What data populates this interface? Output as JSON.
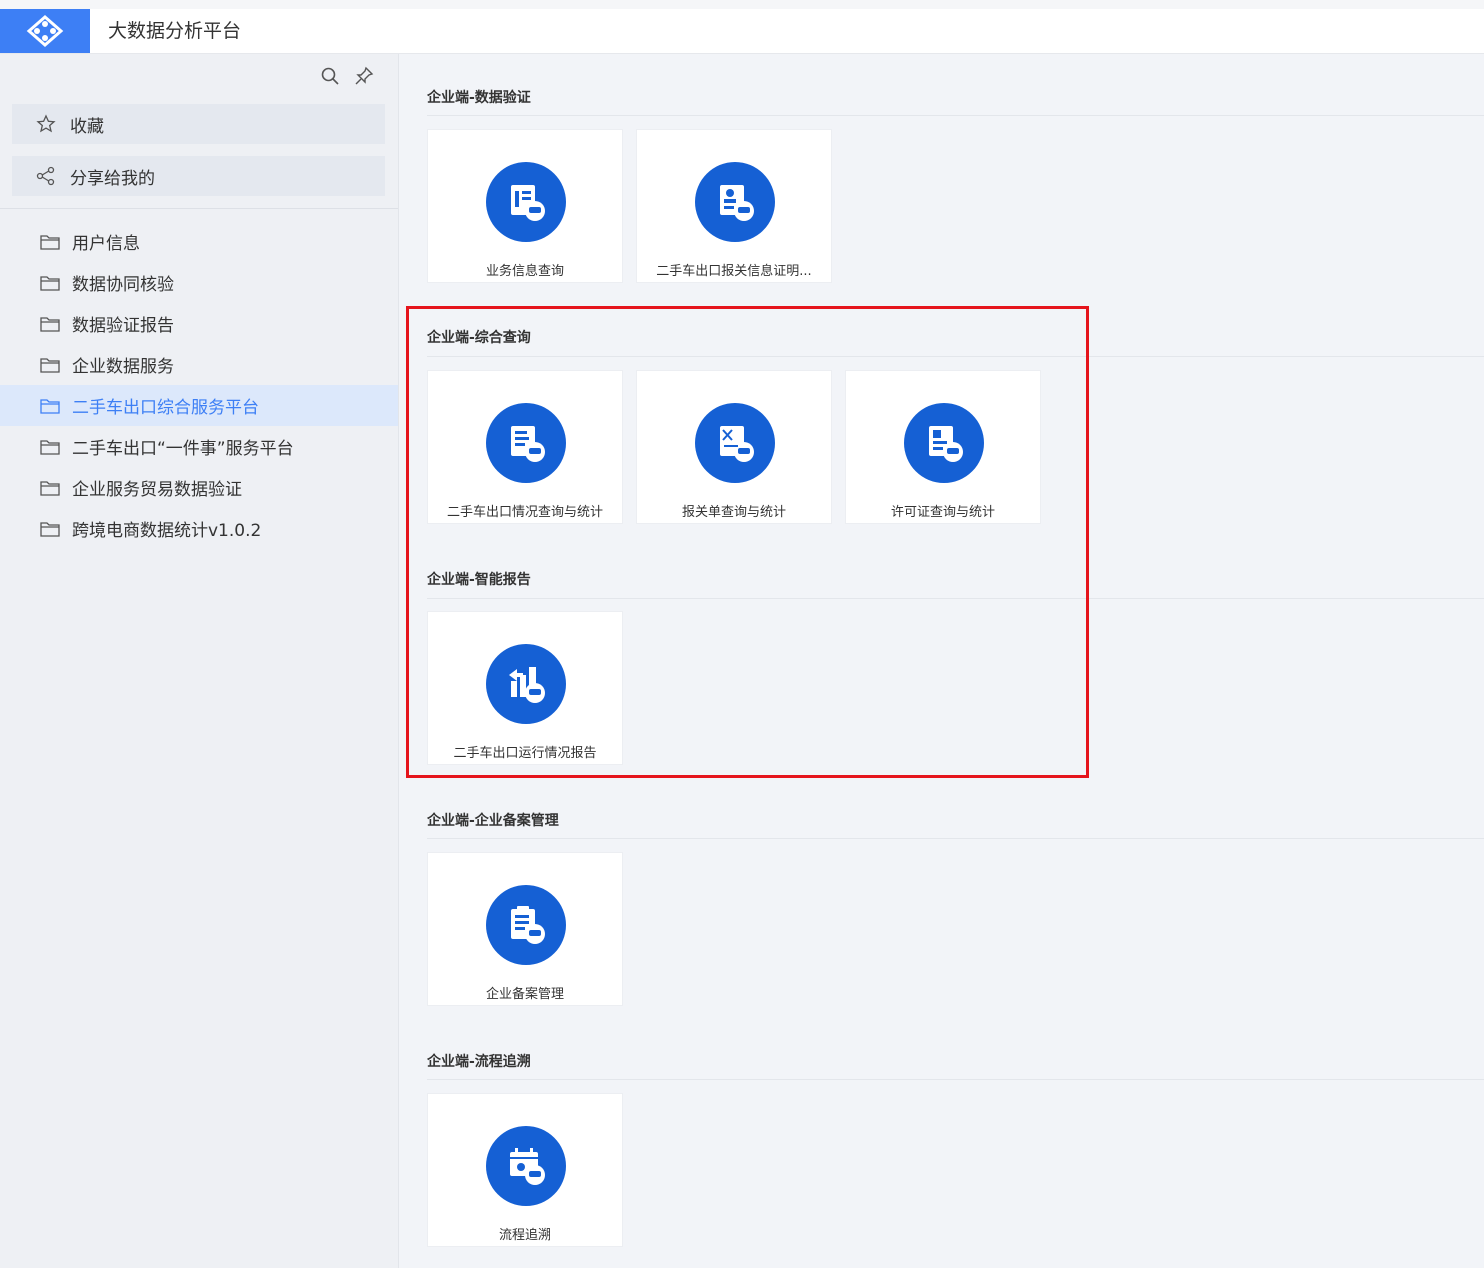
{
  "header": {
    "app_title": "大数据分析平台"
  },
  "sidebar": {
    "favorites": [
      {
        "label": "收藏"
      },
      {
        "label": "分享给我的"
      }
    ],
    "items": [
      {
        "label": "用户信息"
      },
      {
        "label": "数据协同核验"
      },
      {
        "label": "数据验证报告"
      },
      {
        "label": "企业数据服务"
      },
      {
        "label": "二手车出口综合服务平台",
        "active": true
      },
      {
        "label": "二手车出口“一件事”服务平台"
      },
      {
        "label": "企业服务贸易数据验证"
      },
      {
        "label": "跨境电商数据统计v1.0.2"
      }
    ]
  },
  "sections": [
    {
      "title": "企业端-数据验证",
      "cards": [
        {
          "label": "业务信息查询",
          "icon": "document-car-icon"
        },
        {
          "label": "二手车出口报关信息证明...",
          "icon": "profile-car-icon"
        }
      ]
    },
    {
      "title": "企业端-综合查询",
      "cards": [
        {
          "label": "二手车出口情况查询与统计",
          "icon": "document-car-icon"
        },
        {
          "label": "报关单查询与统计",
          "icon": "map-car-icon"
        },
        {
          "label": "许可证查询与统计",
          "icon": "license-car-icon"
        }
      ]
    },
    {
      "title": "企业端-智能报告",
      "cards": [
        {
          "label": "二手车出口运行情况报告",
          "icon": "bar-chart-car-icon"
        }
      ]
    },
    {
      "title": "企业端-企业备案管理",
      "cards": [
        {
          "label": "企业备案管理",
          "icon": "clipboard-car-icon"
        }
      ]
    },
    {
      "title": "企业端-流程追溯",
      "cards": [
        {
          "label": "流程追溯",
          "icon": "calendar-car-icon"
        }
      ]
    }
  ],
  "colors": {
    "accent": "#3d7ff5",
    "icon_circle": "#1560d4",
    "highlight_border": "#e5141c",
    "active_bg": "#dce8fb"
  }
}
